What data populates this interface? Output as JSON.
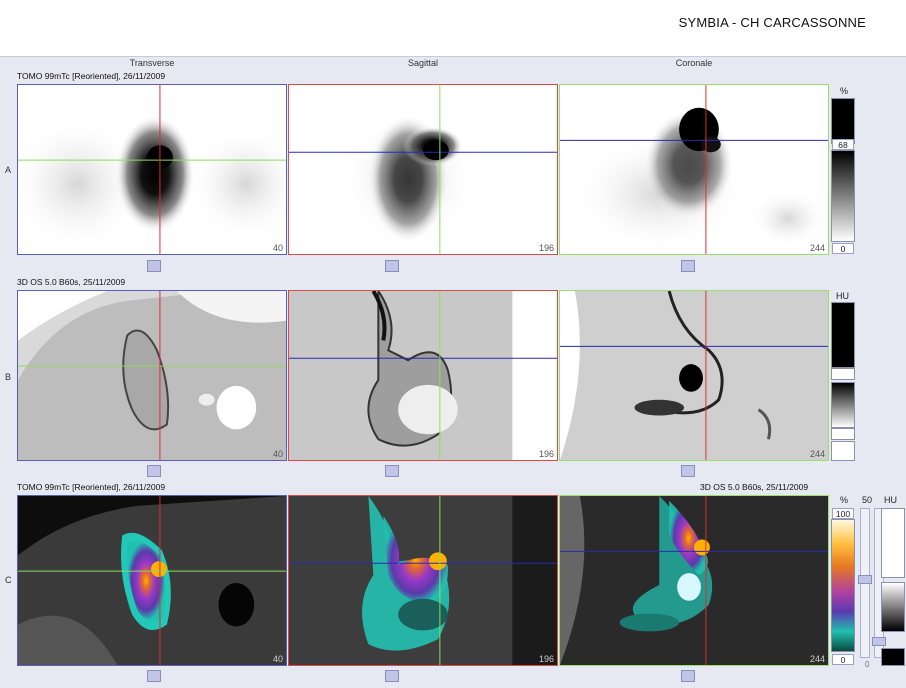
{
  "header": {
    "title": "SYMBIA - CH CARCASSONNE"
  },
  "columns": [
    "Transverse",
    "Sagittal",
    "Coronale"
  ],
  "rows": [
    {
      "label": "A",
      "series": "TOMO 99mTc [Reoriented], 26/11/2009",
      "slices": [
        "40",
        "196",
        "244"
      ]
    },
    {
      "label": "B",
      "series": "3D  OS  5.0  B60s, 25/11/2009",
      "slices": [
        "40",
        "196",
        "244"
      ]
    },
    {
      "label": "C",
      "series": "TOMO 99mTc [Reoriented], 26/11/2009",
      "series_right": "3D  OS  5.0  B60s, 25/11/2009",
      "slices": [
        "40",
        "196",
        "244"
      ]
    }
  ],
  "colorbars": {
    "row_a": {
      "unit": "%",
      "max": "68",
      "min": "0"
    },
    "row_b": {
      "unit": "HU"
    },
    "row_c": {
      "unit_pct": "%",
      "max_pct": "100",
      "min_pct": "0",
      "unit_hu": "HU",
      "threshold": "50",
      "low": "0"
    }
  },
  "colors": {
    "transverse_frame": "#5b5fb8",
    "sagittal_frame": "#d94a4a",
    "coronal_frame": "#9adf6a",
    "crosshair_red": "#d93030",
    "crosshair_green": "#8edc5a",
    "crosshair_blue": "#2a2ab0"
  }
}
